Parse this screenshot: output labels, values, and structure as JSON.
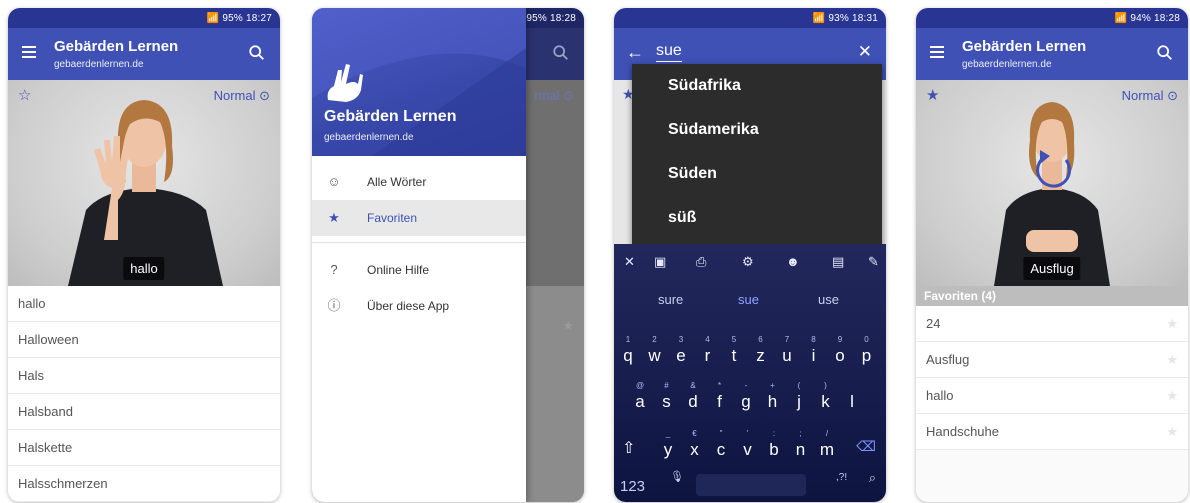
{
  "colors": {
    "primary": "#3f51b5",
    "primary_dark": "#283593",
    "keyboard": "#1a1f4f",
    "suggestion_bg": "#2c2c2c"
  },
  "screen1": {
    "status": "18:27",
    "status_icons": "📶 95%",
    "title": "Gebärden Lernen",
    "subtitle": "gebaerdenlernen.de",
    "speed_label": "Normal",
    "word_label": "hallo",
    "list": [
      "hallo",
      "Halloween",
      "Hals",
      "Halsband",
      "Halskette",
      "Halsschmerzen"
    ]
  },
  "screen2": {
    "status": "18:28",
    "status_icons": "📶 95%",
    "drawer_title": "Gebärden Lernen",
    "drawer_subtitle": "gebaerdenlernen.de",
    "background_speed": "rmal",
    "menu": [
      {
        "label": "Alle Wörter",
        "icon": "smiley-icon"
      },
      {
        "label": "Favoriten",
        "icon": "star-icon"
      },
      {
        "label": "Online Hilfe",
        "icon": "help-icon"
      },
      {
        "label": "Über diese App",
        "icon": "info-icon"
      }
    ]
  },
  "screen3": {
    "status": "18:31",
    "status_icons": "📶 93%",
    "query": "sue",
    "suggestions": [
      "Südafrika",
      "Südamerika",
      "Süden",
      "süß"
    ],
    "kb_suggestions": [
      "sure",
      "sue",
      "use"
    ],
    "row1": [
      [
        "1",
        "q"
      ],
      [
        "2",
        "w"
      ],
      [
        "3",
        "e"
      ],
      [
        "4",
        "r"
      ],
      [
        "5",
        "t"
      ],
      [
        "6",
        "z"
      ],
      [
        "7",
        "u"
      ],
      [
        "8",
        "i"
      ],
      [
        "9",
        "o"
      ],
      [
        "0",
        "p"
      ]
    ],
    "row2": [
      [
        "@",
        "a"
      ],
      [
        "#",
        "s"
      ],
      [
        "&",
        "d"
      ],
      [
        "*",
        "f"
      ],
      [
        "-",
        "g"
      ],
      [
        "+",
        "h"
      ],
      [
        "(",
        "j"
      ],
      [
        ")",
        "k"
      ],
      [
        "",
        "l"
      ]
    ],
    "row3": [
      [
        "_",
        "y"
      ],
      [
        "€",
        "x"
      ],
      [
        "\"",
        "c"
      ],
      [
        "'",
        "v"
      ],
      [
        ":",
        "b"
      ],
      [
        ";",
        "n"
      ],
      [
        "/",
        "m"
      ]
    ],
    "numbers_key": "123"
  },
  "screen4": {
    "status": "18:28",
    "status_icons": "📶 94%",
    "title": "Gebärden Lernen",
    "subtitle": "gebaerdenlernen.de",
    "speed_label": "Normal",
    "word_label": "Ausflug",
    "favorites_header": "Favoriten (4)",
    "list": [
      "24",
      "Ausflug",
      "hallo",
      "Handschuhe"
    ]
  }
}
